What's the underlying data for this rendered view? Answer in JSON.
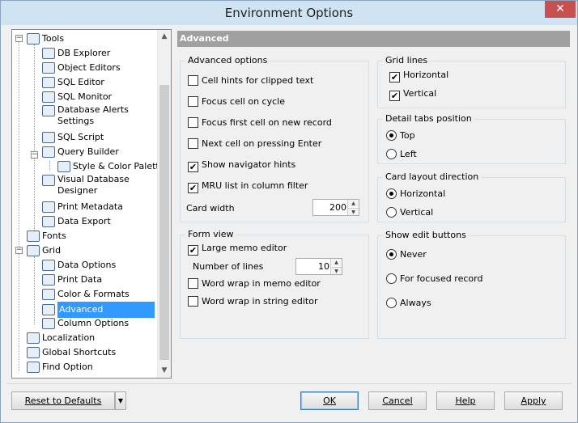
{
  "window": {
    "title": "Environment Options",
    "close_glyph": "✕"
  },
  "tree": {
    "items": [
      {
        "label": "Tools",
        "icon": "tools-icon",
        "expander": "−"
      },
      {
        "label": "DB Explorer",
        "icon": "db-explorer-icon"
      },
      {
        "label": "Object Editors",
        "icon": "object-editors-icon"
      },
      {
        "label": "SQL Editor",
        "icon": "sql-editor-icon"
      },
      {
        "label": "SQL Monitor",
        "icon": "sql-monitor-icon"
      },
      {
        "label": "Database Alerts Settings",
        "icon": "database-alerts-icon"
      },
      {
        "label": "SQL Script",
        "icon": "sql-script-icon"
      },
      {
        "label": "Query Builder",
        "icon": "query-builder-icon",
        "expander": "−"
      },
      {
        "label": "Style & Color Palette",
        "icon": "color-palette-icon"
      },
      {
        "label": "Visual Database Designer",
        "icon": "visual-designer-icon"
      },
      {
        "label": "Print Metadata",
        "icon": "print-metadata-icon"
      },
      {
        "label": "Data Export",
        "icon": "data-export-icon"
      },
      {
        "label": "Fonts",
        "icon": "fonts-icon"
      },
      {
        "label": "Grid",
        "icon": "grid-icon",
        "expander": "−"
      },
      {
        "label": "Data Options",
        "icon": "data-options-icon"
      },
      {
        "label": "Print Data",
        "icon": "print-data-icon"
      },
      {
        "label": "Color & Formats",
        "icon": "color-formats-icon"
      },
      {
        "label": "Advanced",
        "icon": "advanced-icon",
        "selected": true
      },
      {
        "label": "Column Options",
        "icon": "column-options-icon"
      },
      {
        "label": "Localization",
        "icon": "localization-icon"
      },
      {
        "label": "Global Shortcuts",
        "icon": "global-shortcuts-icon"
      },
      {
        "label": "Find Option",
        "icon": "find-option-icon"
      }
    ]
  },
  "content": {
    "header": "Advanced",
    "advanced_options": {
      "title": "Advanced options",
      "options": [
        {
          "label": "Cell hints for clipped text",
          "checked": false
        },
        {
          "label": "Focus cell on cycle",
          "checked": false
        },
        {
          "label": "Focus first cell on new record",
          "checked": false
        },
        {
          "label": "Next cell on pressing Enter",
          "checked": false
        },
        {
          "label": "Show navigator hints",
          "checked": true
        },
        {
          "label": "MRU list in column filter",
          "checked": true
        }
      ],
      "card_width_label": "Card width",
      "card_width_value": "200"
    },
    "form_view": {
      "title": "Form view",
      "large_memo_label": "Large memo editor",
      "number_of_lines_label": "Number of lines",
      "number_of_lines_value": "10",
      "word_wrap_memo_label": "Word wrap in memo editor",
      "word_wrap_string_label": "Word wrap in string editor"
    },
    "grid_lines": {
      "title": "Grid lines",
      "horizontal": "Horizontal",
      "vertical": "Vertical"
    },
    "detail_tabs": {
      "title": "Detail tabs position",
      "top": "Top",
      "left": "Left"
    },
    "card_layout": {
      "title": "Card layout direction",
      "horizontal": "Horizontal",
      "vertical": "Vertical"
    },
    "show_edit_buttons": {
      "title": "Show edit buttons",
      "never": "Never",
      "for_focused": "For focused record",
      "always": "Always"
    }
  },
  "buttons": {
    "reset": "Reset to Defaults",
    "reset_dropdown": "▼",
    "ok": "OK",
    "cancel": "Cancel",
    "help": "Help",
    "apply": "Apply"
  },
  "glyphs": {
    "check": "✔",
    "up": "▲",
    "down": "▼"
  }
}
